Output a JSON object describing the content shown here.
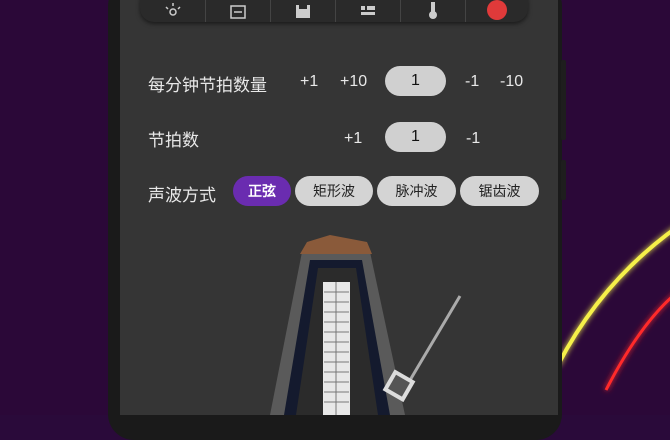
{
  "toolbar": {
    "icons": [
      "brightness-icon",
      "calculator-icon",
      "save-icon",
      "list-icon",
      "thermometer-icon",
      "record-icon"
    ]
  },
  "bpm": {
    "label": "每分钟节拍数量",
    "plus1": "+1",
    "plus10": "+10",
    "value": "1",
    "minus1": "-1",
    "minus10": "-10"
  },
  "beats": {
    "label": "节拍数",
    "plus1": "+1",
    "value": "1",
    "minus1": "-1"
  },
  "waveform": {
    "label": "声波方式",
    "options": [
      "正弦",
      "矩形波",
      "脉冲波",
      "锯齿波"
    ],
    "selected": "正弦"
  },
  "colors": {
    "accent": "#6a2cb0",
    "background": "#2b0838",
    "panel": "#353535",
    "neon_yellow": "#f5f04a",
    "neon_red": "#ff2a2a"
  }
}
